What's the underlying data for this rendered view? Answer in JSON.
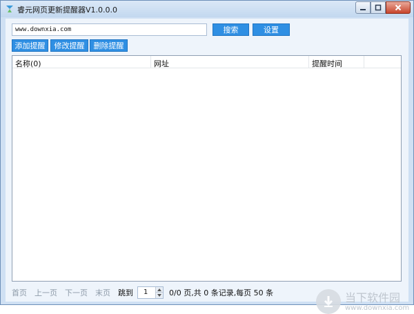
{
  "window": {
    "title": "睿元网页更新提醒器V1.0.0.0",
    "accent": "#2f8fe3"
  },
  "toolbar": {
    "url_value": "www.downxia.com",
    "search_label": "搜索",
    "settings_label": "设置",
    "add_label": "添加提醒",
    "edit_label": "修改提醒",
    "delete_label": "删除提醒"
  },
  "table": {
    "columns": [
      "名称(0)",
      "网址",
      "提醒时间",
      ""
    ],
    "rows": []
  },
  "pager": {
    "first": "首页",
    "prev": "上一页",
    "next": "下一页",
    "last": "末页",
    "jump_label": "跳到",
    "page_value": "1",
    "info": "0/0 页,共 0 条记录,每页 50 条"
  },
  "watermark": {
    "name": "当下软件园",
    "url": "www.downxia.com"
  },
  "icons": [
    "app-icon",
    "minimize-icon",
    "maximize-icon",
    "close-icon",
    "spin-up-icon",
    "spin-down-icon",
    "watermark-logo"
  ]
}
